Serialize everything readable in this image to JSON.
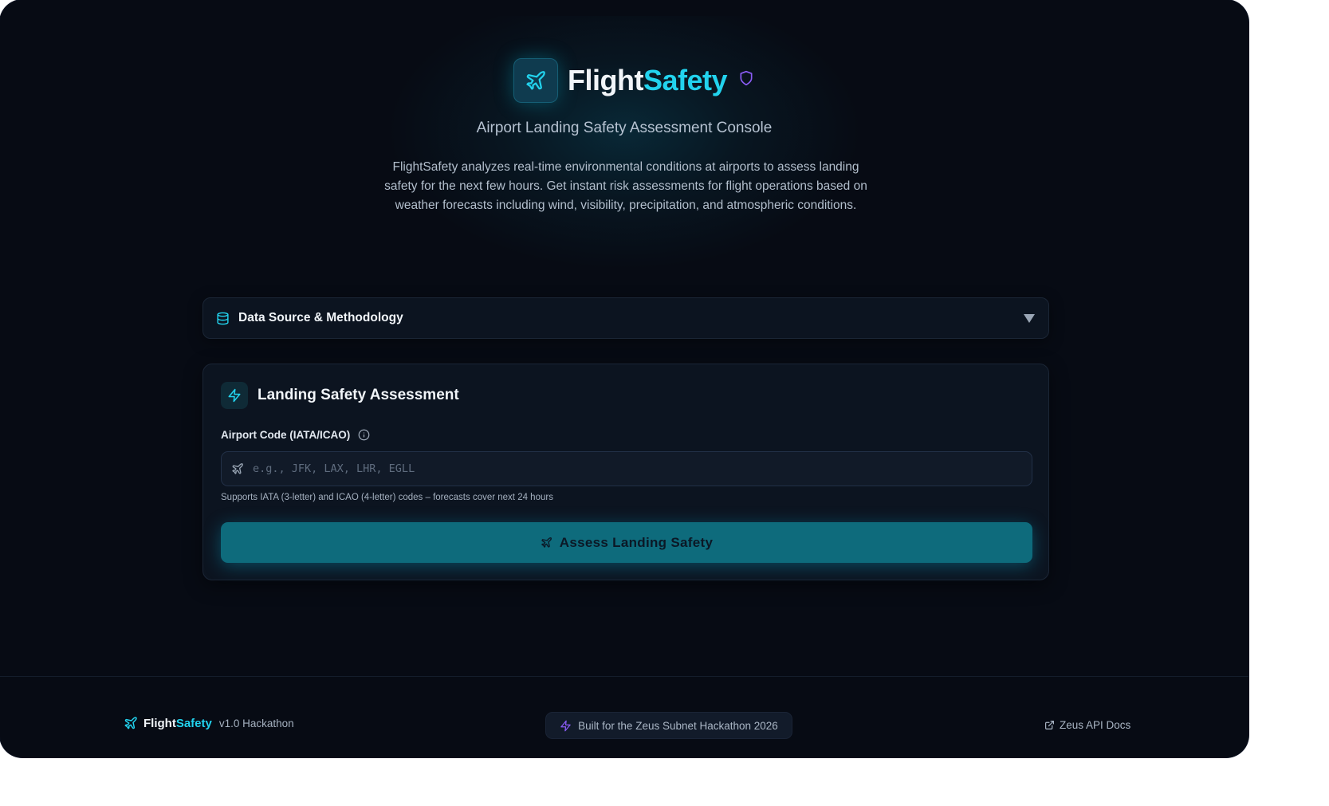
{
  "colors": {
    "accent": "#22d3ee",
    "background": "#070b14",
    "button": "#0e6b7c",
    "shield": "#8b5cf6"
  },
  "header": {
    "brand_part1": "Flight",
    "brand_part2": "Safety",
    "subtitle": "Airport Landing Safety Assessment Console",
    "description": "FlightSafety analyzes real-time environmental conditions at airports to assess landing safety for the next few hours. Get instant risk assessments for flight operations based on weather forecasts including wind, visibility, precipitation, and atmospheric conditions."
  },
  "accordion": {
    "icon": "database-icon",
    "title": "Data Source & Methodology",
    "expanded": false
  },
  "assessment": {
    "icon": "bolt-icon",
    "title": "Landing Safety Assessment",
    "field_label": "Airport Code (IATA/ICAO)",
    "placeholder": "e.g., JFK, LAX, LHR, EGLL",
    "value": "",
    "hint": "Supports IATA (3-letter) and ICAO (4-letter) codes – forecasts cover next 24 hours",
    "button_label": "Assess Landing Safety"
  },
  "footer": {
    "brand_part1": "Flight",
    "brand_part2": "Safety",
    "version": "v1.0 Hackathon",
    "badge": "Built for the Zeus Subnet Hackathon 2026",
    "link": "Zeus API Docs"
  }
}
